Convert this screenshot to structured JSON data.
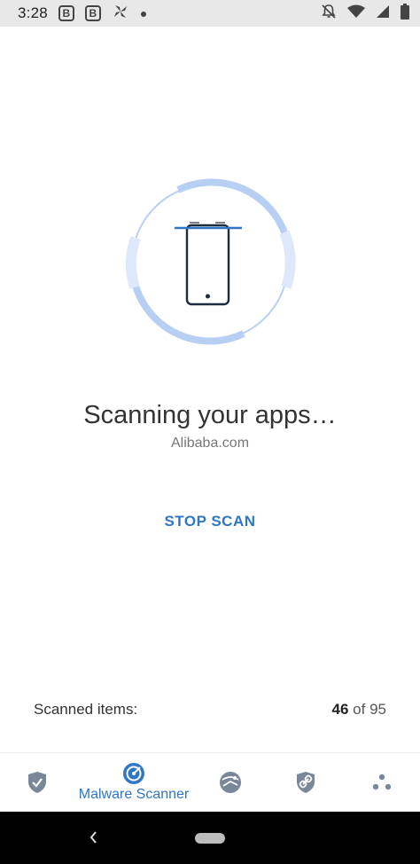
{
  "status_bar": {
    "time": "3:28",
    "badge_1": "B",
    "badge_2": "B",
    "icons": [
      "b-badge-icon",
      "b-badge-icon",
      "pinwheel-icon",
      "dot-icon",
      "notifications-off-icon",
      "wifi-icon",
      "signal-icon",
      "battery-icon"
    ]
  },
  "scan": {
    "title": "Scanning your apps…",
    "current_app": "Alibaba.com",
    "stop_label": "STOP SCAN",
    "accent_color": "#2f76c7",
    "ring_color": "#b7cff3"
  },
  "progress": {
    "label": "Scanned items:",
    "scanned": "46",
    "separator": " of ",
    "total": "95"
  },
  "bottom_nav": {
    "items": [
      {
        "icon": "shield-check-icon",
        "label": ""
      },
      {
        "icon": "malware-scanner-icon",
        "label": "Malware Scanner",
        "active": true
      },
      {
        "icon": "web-protection-icon",
        "label": ""
      },
      {
        "icon": "link-shield-icon",
        "label": ""
      },
      {
        "icon": "more-dots-icon",
        "label": ""
      }
    ]
  }
}
